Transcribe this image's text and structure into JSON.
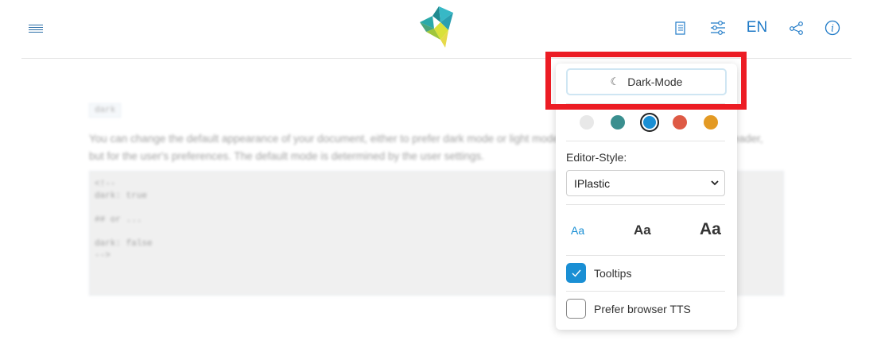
{
  "header": {
    "menu_icon": "hamburger-icon",
    "logo_icon": "origami-bird-logo",
    "icons": [
      "book-icon",
      "sliders-icon",
      "share-icon",
      "info-icon"
    ],
    "language": "EN"
  },
  "content": {
    "tag": "dark",
    "paragraph": "You can change the default appearance of your document, either to prefer dark mode or light mode, by setting the dark property in the header, but for the user's preferences. The default mode is determined by the user settings.",
    "code_lines": [
      "<!--",
      "dark: true",
      "",
      "## or ...",
      "",
      "dark: false",
      "-->"
    ]
  },
  "settings_panel": {
    "dark_mode_label": "Dark-Mode",
    "moon_icon": "moon-icon",
    "color_swatches": [
      {
        "name": "default",
        "color": "#e8e8e8",
        "selected": false
      },
      {
        "name": "teal",
        "color": "#3a8f8f",
        "selected": false
      },
      {
        "name": "blue",
        "color": "#1a8fd4",
        "selected": true
      },
      {
        "name": "red",
        "color": "#de5a45",
        "selected": false
      },
      {
        "name": "orange",
        "color": "#e39a24",
        "selected": false
      }
    ],
    "editor_style_label": "Editor-Style:",
    "editor_style_value": "IPlastic",
    "font_sizes": [
      "Aa",
      "Aa",
      "Aa"
    ],
    "font_size_selected": 0,
    "tooltips_label": "Tooltips",
    "tooltips_checked": true,
    "tts_label": "Prefer browser TTS",
    "tts_checked": false
  },
  "colors": {
    "accent": "#1a8fd4",
    "highlight": "#ec1c24"
  }
}
